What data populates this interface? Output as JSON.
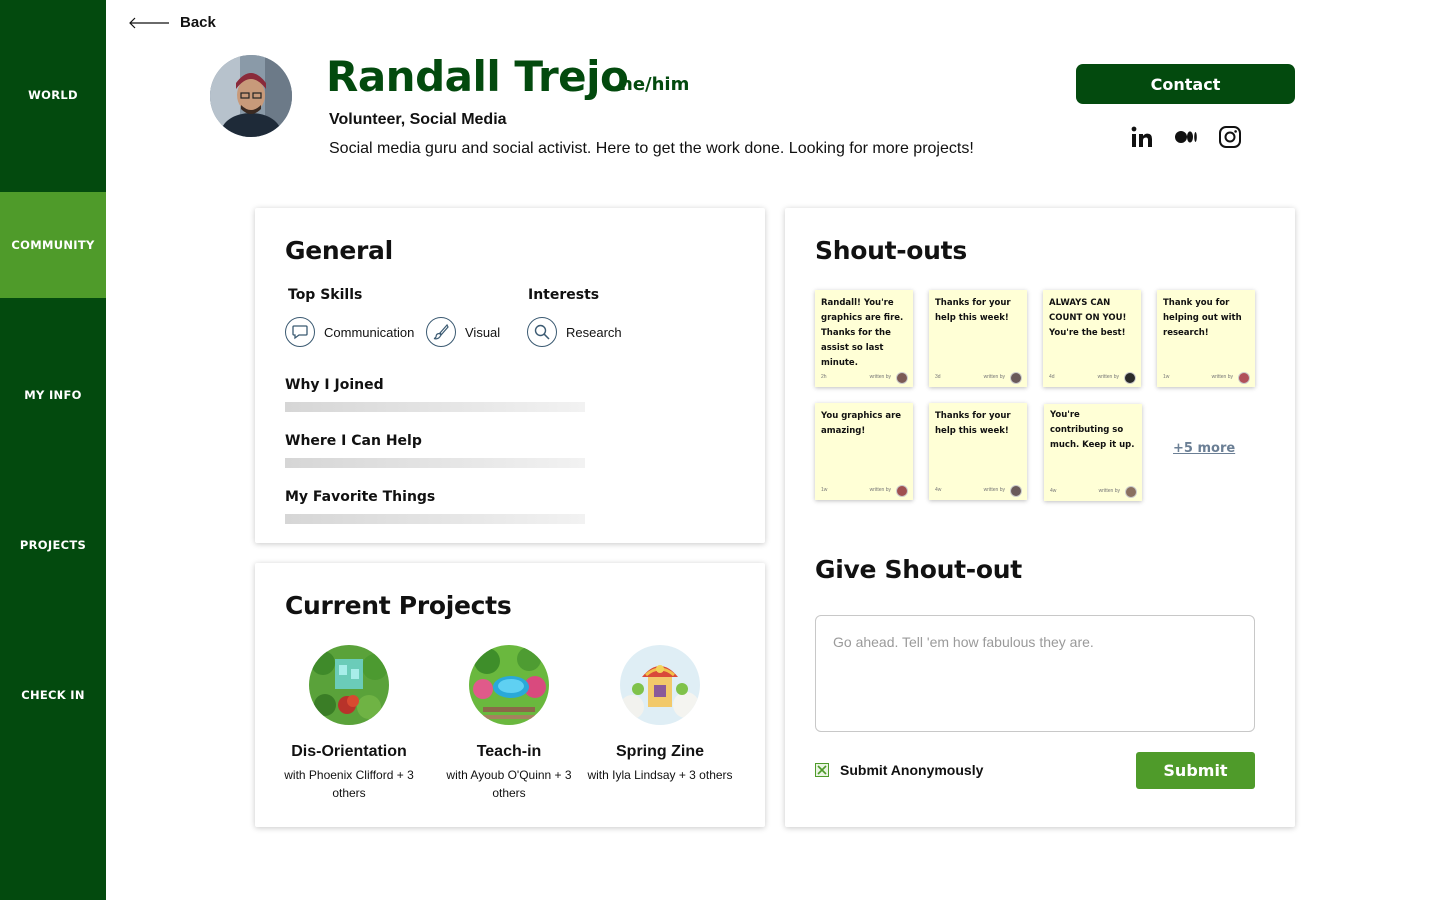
{
  "nav": {
    "items": [
      {
        "label": "WORLD"
      },
      {
        "label": "COMMUNITY"
      },
      {
        "label": "MY INFO"
      },
      {
        "label": "PROJECTS"
      },
      {
        "label": "CHECK IN"
      }
    ],
    "active": "COMMUNITY"
  },
  "header": {
    "back_label": "Back",
    "name": "Randall Trejo",
    "pronouns": "he/him",
    "role": "Volunteer, Social Media",
    "bio": "Social media guru and social activist. Here to get the work done. Looking for more projects!",
    "contact_label": "Contact",
    "socials": [
      "linkedin-icon",
      "medium-icon",
      "instagram-icon"
    ]
  },
  "general": {
    "title": "General",
    "top_skills_label": "Top Skills",
    "interests_label": "Interests",
    "skills": [
      "Communication",
      "Visual"
    ],
    "interests": [
      "Research"
    ],
    "sections": [
      "Why I Joined",
      "Where I Can Help",
      "My Favorite Things"
    ]
  },
  "projects": {
    "title": "Current Projects",
    "items": [
      {
        "name": "Dis-Orientation",
        "members": "with Phoenix Clifford + 3 others"
      },
      {
        "name": "Teach-in",
        "members": "with Ayoub O'Quinn + 3 others"
      },
      {
        "name": "Spring Zine",
        "members": "with Iyla Lindsay + 3 others"
      }
    ]
  },
  "shoutouts": {
    "title": "Shout-outs",
    "written_by": "written by",
    "notes": [
      {
        "text": "Randall! You're graphics are fire. Thanks for the assist so last minute.",
        "time": "2h"
      },
      {
        "text": "Thanks for your help this week!",
        "time": "3d"
      },
      {
        "text": "ALWAYS CAN COUNT ON YOU! You're the best!",
        "time": "4d"
      },
      {
        "text": "Thank you for helping out with research!",
        "time": "1w"
      },
      {
        "text": "You graphics are amazing!",
        "time": "1w"
      },
      {
        "text": "Thanks for your help this week!",
        "time": "4w"
      },
      {
        "text": "You're contributing so much. Keep it up.",
        "time": "4w"
      }
    ],
    "more_label": "+5 more"
  },
  "give_shoutout": {
    "title": "Give Shout-out",
    "placeholder": "Go ahead. Tell 'em how fabulous they are.",
    "anonymous_label": "Submit Anonymously",
    "anonymous_checked": true,
    "submit_label": "Submit"
  },
  "colors": {
    "sidebar": "#034a0e",
    "active_nav": "#4f9b2a",
    "primary_text": "#034a0e",
    "note_bg": "#ffffd6"
  }
}
